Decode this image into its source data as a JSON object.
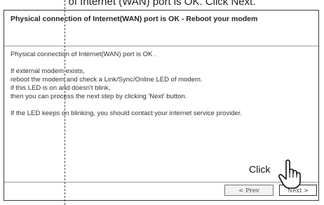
{
  "instruction": "of Internet (WAN) port is OK. Click Next.",
  "dialog": {
    "title": "Physical connection of Internet(WAN) port is OK - Reboot your modem",
    "lines": [
      "Physical connection of Internet(WAN) port is OK .",
      "If external modem exists,",
      "reboot the modem and check a Link/Sync/Online LED of modem.",
      "if this LED is on and doesn't blink,",
      "then you can process the next step by clicking 'Next' button.",
      "If the LED keeps on blinking, you should contact your internet service provider."
    ],
    "prev_label": "< Prev",
    "next_label": "Next >"
  },
  "callout": {
    "click_label": "Click",
    "icon": "pointing-hand-icon"
  }
}
